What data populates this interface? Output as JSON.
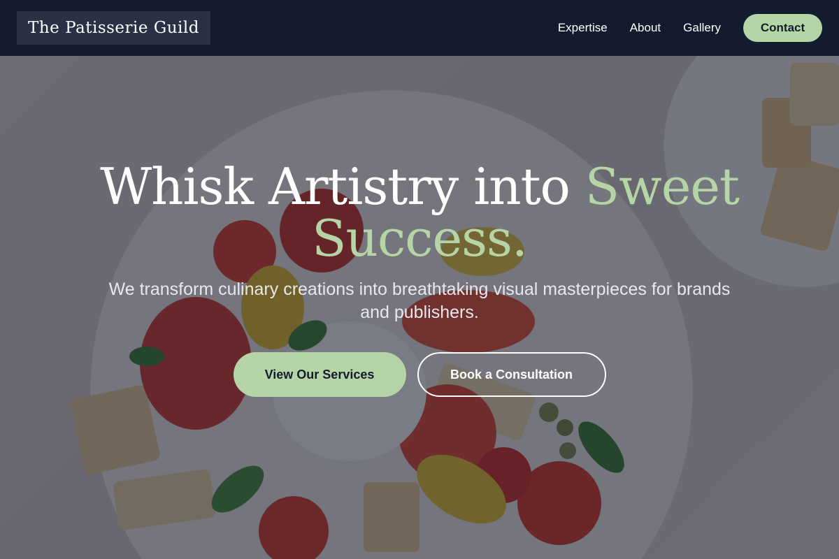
{
  "header": {
    "logo_text": "The Patisserie Guild",
    "nav": {
      "expertise": "Expertise",
      "about": "About",
      "gallery": "Gallery",
      "contact": "Contact"
    }
  },
  "hero": {
    "headline_main": "Whisk Artistry into ",
    "headline_accent": "Sweet Success.",
    "subheadline": "We transform culinary creations into breathtaking visual masterpieces for brands and publishers.",
    "primary_cta": "View Our Services",
    "secondary_cta": "Book a Consultation"
  },
  "colors": {
    "header_bg": "#141b2e",
    "accent_green": "#b6d5a6",
    "text_white": "#ffffff"
  }
}
